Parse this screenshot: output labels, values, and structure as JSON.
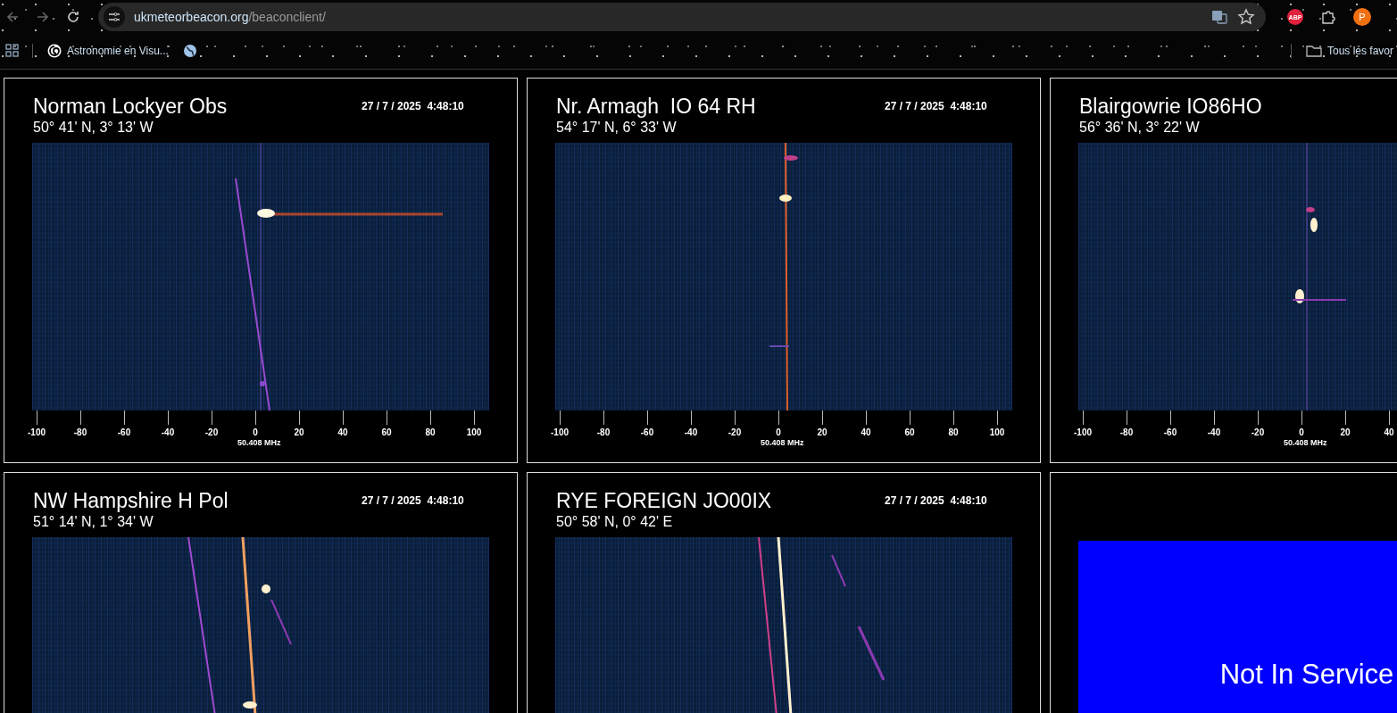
{
  "browser": {
    "url": {
      "host": "ukmeteorbeacon.org",
      "path": "/beaconclient/"
    },
    "extension_badge": "ABP",
    "profile_initial": "P"
  },
  "bookmarks": {
    "items": [
      "Astronomie en Visu..."
    ],
    "all_bookmarks": "Tous les favor"
  },
  "cards": [
    {
      "kind": "spectrogram",
      "title": "Norman Lockyer Obs",
      "coords": "50° 41' N, 3° 13' W",
      "timestamp": "27 / 7 / 2025  4:48:10",
      "axis": {
        "ticks": [
          "-100",
          "-80",
          "-60",
          "-40",
          "-20",
          "0",
          "20",
          "40",
          "60",
          "80",
          "100"
        ],
        "title": "50.408 MHz"
      }
    },
    {
      "kind": "spectrogram",
      "title": "Nr. Armagh  IO 64 RH",
      "coords": "54° 17' N, 6° 33' W",
      "timestamp": "27 / 7 / 2025  4:48:10",
      "axis": {
        "ticks": [
          "-100",
          "-80",
          "-60",
          "-40",
          "-20",
          "0",
          "20",
          "40",
          "60",
          "80",
          "100"
        ],
        "title": "50.408 MHz"
      }
    },
    {
      "kind": "spectrogram",
      "title": "Blairgowrie IO86HO",
      "coords": "56° 36' N, 3° 22' W",
      "axis": {
        "ticks": [
          "-100",
          "-80",
          "-60",
          "-40",
          "-20",
          "0",
          "20",
          "40"
        ],
        "title": "50.408 MHz"
      }
    },
    {
      "kind": "spectrogram",
      "title": "NW Hampshire H Pol",
      "coords": "51° 14' N, 1° 34' W",
      "timestamp": "27 / 7 / 2025  4:48:10"
    },
    {
      "kind": "spectrogram",
      "title": "RYE FOREIGN JO00IX",
      "coords": "50° 58' N, 0° 42' E",
      "timestamp": "27 / 7 / 2025  4:48:10"
    },
    {
      "kind": "not_in_service",
      "message": "Not In Service"
    }
  ]
}
